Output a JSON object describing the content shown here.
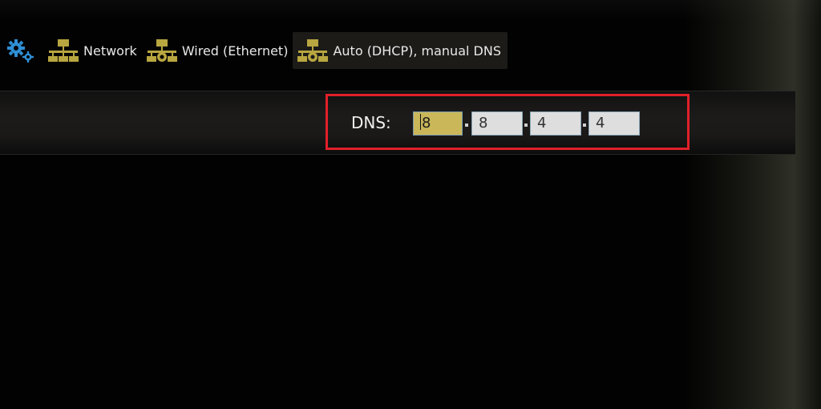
{
  "breadcrumb": {
    "items": [
      {
        "label": "Network",
        "icon": "network-icon"
      },
      {
        "label": "Wired (Ethernet)",
        "icon": "wired-network-icon"
      },
      {
        "label": "Auto (DHCP), manual DNS",
        "icon": "dhcp-network-icon"
      }
    ],
    "settings_icon": "gear-icon"
  },
  "dns": {
    "label": "DNS:",
    "octets": [
      "8",
      "8",
      "4",
      "4"
    ],
    "separator": ".",
    "focused_index": 0
  },
  "colors": {
    "background": "#020202",
    "icon_gold": "#b8a640",
    "gear_blue": "#2e8fd6",
    "focused_field": "#c9b75a",
    "field": "#dedede",
    "highlight_border": "#e0202a"
  }
}
